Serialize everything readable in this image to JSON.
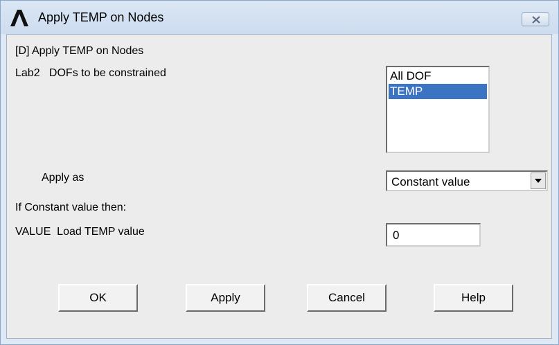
{
  "window": {
    "title": "Apply TEMP on Nodes",
    "logo_icon": "ansys-logo-icon",
    "close_icon": "close-icon"
  },
  "dialog": {
    "heading": "[D] Apply TEMP on Nodes",
    "lab2_label": "Lab2   DOFs to be constrained",
    "dof_list": {
      "items": [
        "All DOF",
        "TEMP"
      ],
      "selected": "TEMP"
    },
    "apply_as_label": "Apply as",
    "apply_as_value": "Constant value",
    "if_constant_label": "If Constant value then:",
    "value_label": "VALUE  Load TEMP value",
    "value_input": "0"
  },
  "buttons": {
    "ok": "OK",
    "apply": "Apply",
    "cancel": "Cancel",
    "help": "Help"
  },
  "colors": {
    "selection": "#3a74c2",
    "titlebar": "#dbe7f5",
    "dialog_bg": "#ececec"
  }
}
